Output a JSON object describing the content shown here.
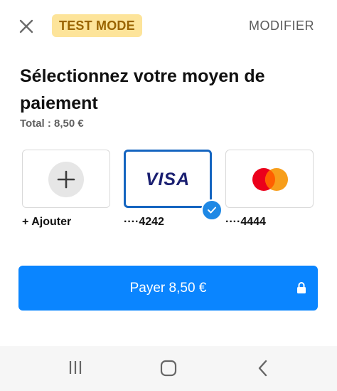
{
  "header": {
    "badge": "TEST MODE",
    "modify": "MODIFIER"
  },
  "title": "Sélectionnez votre moyen de paiement",
  "total": "Total : 8,50 €",
  "payment_methods": [
    {
      "label": "+ Ajouter",
      "selected": false,
      "icon": "plus-icon"
    },
    {
      "label": "····4242",
      "brand": "VISA",
      "selected": true,
      "icon": "visa-logo"
    },
    {
      "label": "····4444",
      "brand": "Mastercard",
      "selected": false,
      "icon": "mastercard-logo"
    }
  ],
  "pay_button": {
    "label": "Payer 8,50 €",
    "icon": "lock-icon"
  },
  "colors": {
    "accent": "#0a85ff",
    "selected_border": "#1565c0",
    "badge_bg": "#fde49a",
    "badge_text": "#9a6400"
  },
  "nav": {
    "icons": [
      "recents-icon",
      "home-icon",
      "back-icon"
    ]
  }
}
